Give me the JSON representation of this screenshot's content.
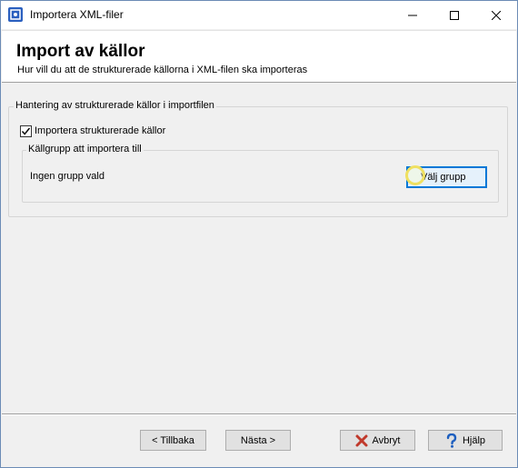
{
  "window": {
    "title": "Importera XML-filer",
    "app_icon": "app-icon",
    "controls": [
      "minimize-icon",
      "maximize-icon",
      "close-icon"
    ]
  },
  "header": {
    "title": "Import av källor",
    "subtitle": "Hur vill du att de strukturerade källorna i XML-filen ska importeras"
  },
  "group_main": {
    "legend": "Hantering av strukturerade källor i importfilen",
    "checkbox_label": "Importera strukturerade källor",
    "checkbox_checked": true
  },
  "group_source": {
    "legend": "Källgrupp att importera till",
    "status": "Ingen grupp vald",
    "select_button": "Välj grupp"
  },
  "footer": {
    "back": "< Tillbaka",
    "next": "Nästa >",
    "cancel": "Avbryt",
    "help": "Hjälp"
  },
  "colors": {
    "accent": "#0078d7",
    "cancel_icon": "#c0392b",
    "help_icon": "#1e5fbf",
    "cursor_highlight": "#f0e060"
  }
}
